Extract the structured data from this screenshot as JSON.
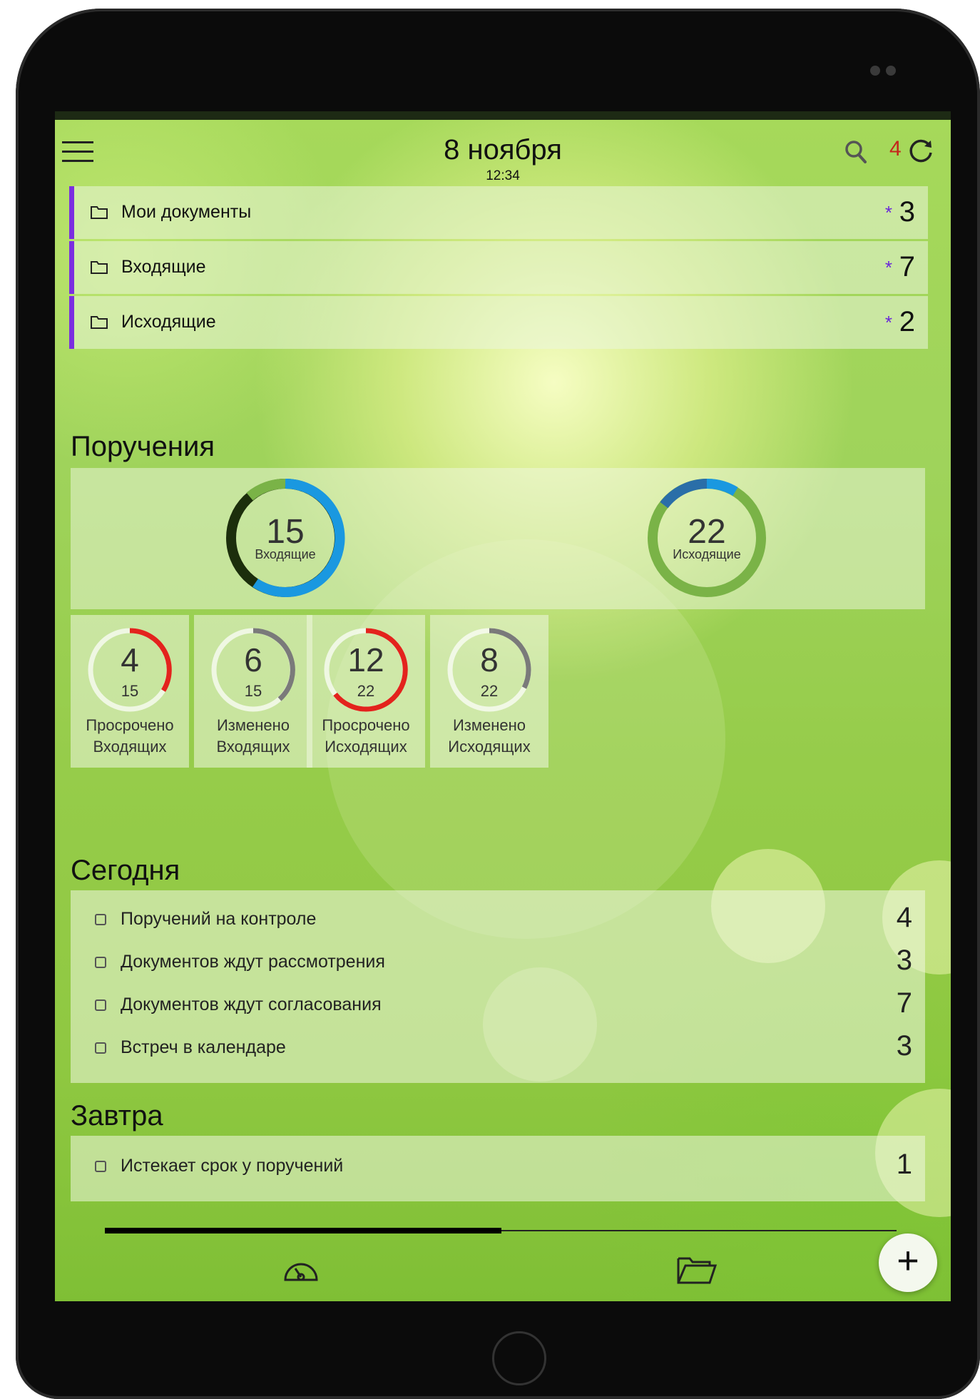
{
  "header": {
    "date": "8 ноября",
    "time": "12:34",
    "sync_count": "4"
  },
  "folders": [
    {
      "label": "Мои документы",
      "marker": "*",
      "count": "3"
    },
    {
      "label": "Входящие",
      "marker": "*",
      "count": "7"
    },
    {
      "label": "Исходящие",
      "marker": "*",
      "count": "2"
    }
  ],
  "assignments": {
    "title": "Поручения",
    "incoming": {
      "value": "15",
      "label": "Входящие"
    },
    "outgoing": {
      "value": "22",
      "label": "Исходящие"
    },
    "tiles": [
      {
        "value": "4",
        "total": "15",
        "caption1": "Просрочено",
        "caption2": "Входящих",
        "color": "#e3231d"
      },
      {
        "value": "6",
        "total": "15",
        "caption1": "Изменено",
        "caption2": "Входящих",
        "color": "#7a7a7a"
      },
      {
        "value": "12",
        "total": "22",
        "caption1": "Просрочено",
        "caption2": "Исходящих",
        "color": "#e3231d"
      },
      {
        "value": "8",
        "total": "22",
        "caption1": "Изменено",
        "caption2": "Исходящих",
        "color": "#7a7a7a"
      }
    ]
  },
  "today": {
    "title": "Сегодня",
    "items": [
      {
        "label": "Поручений на контроле",
        "count": "4"
      },
      {
        "label": "Документов ждут рассмотрения",
        "count": "3"
      },
      {
        "label": "Документов ждут согласования",
        "count": "7"
      },
      {
        "label": "Встреч в календаре",
        "count": "3"
      }
    ]
  },
  "tomorrow": {
    "title": "Завтра",
    "items": [
      {
        "label": "Истекает срок у поручений",
        "count": "1"
      }
    ]
  },
  "tabbar": {
    "tabs": [
      "dashboard-icon",
      "folder-open-icon"
    ],
    "fab": "+"
  },
  "colors": {
    "accent_purple": "#7b2ee0",
    "sync_red": "#c4261c",
    "ring_blue": "#1a98e0",
    "ring_dark": "#1c2e0c",
    "ring_green": "#7ab347",
    "overdue_red": "#e3231d",
    "changed_grey": "#7a7a7a"
  }
}
